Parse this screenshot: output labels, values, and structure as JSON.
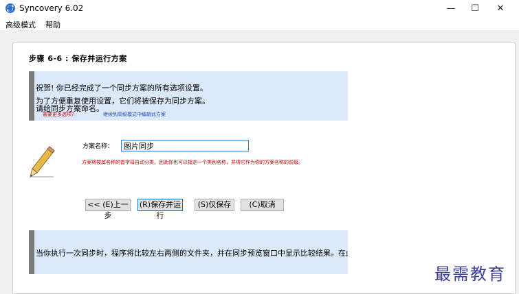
{
  "window": {
    "title": "Syncovery 6.02",
    "minimize_glyph": "—",
    "maximize_glyph": "☐",
    "close_glyph": "✕"
  },
  "menu": {
    "items": [
      "高级模式",
      "帮助"
    ]
  },
  "step": {
    "title": "步骤 6-6 : 保存并运行方案"
  },
  "info": {
    "line1": "祝贺! 你已经完成了一个同步方案的所有选项设置。",
    "line2": "为了方便重复使用设置，它们将被保存为同步方案。",
    "line3": "请给同步方案命名。",
    "small_red": "需要更多选项?",
    "small_blue": "继续到高级模式中编辑此方案"
  },
  "form": {
    "label": "方案名称：",
    "value": "图片同步",
    "hint": "方案将按其名称的首字母自动分类。因此你也可以指定一个类别名称，并将它作为你的方案名称的前缀。"
  },
  "buttons": {
    "back": "<< (E)上一步",
    "save_run": "(R)保存并运行",
    "save_only": "(S)仅保存",
    "cancel": "(C)取消"
  },
  "bottom": {
    "text": "当你执行一次同步时，程序将比较左右两侧的文件夹，并在同步预览窗口中显示比较结果。在此你将"
  },
  "watermark": {
    "text": "最需教育"
  },
  "colors": {
    "info_bg": "#dce9fa",
    "bar": "#7a7a7a",
    "hint_red": "#c00000",
    "link_blue": "#1f4fb0",
    "watermark": "#3b3f9a"
  }
}
